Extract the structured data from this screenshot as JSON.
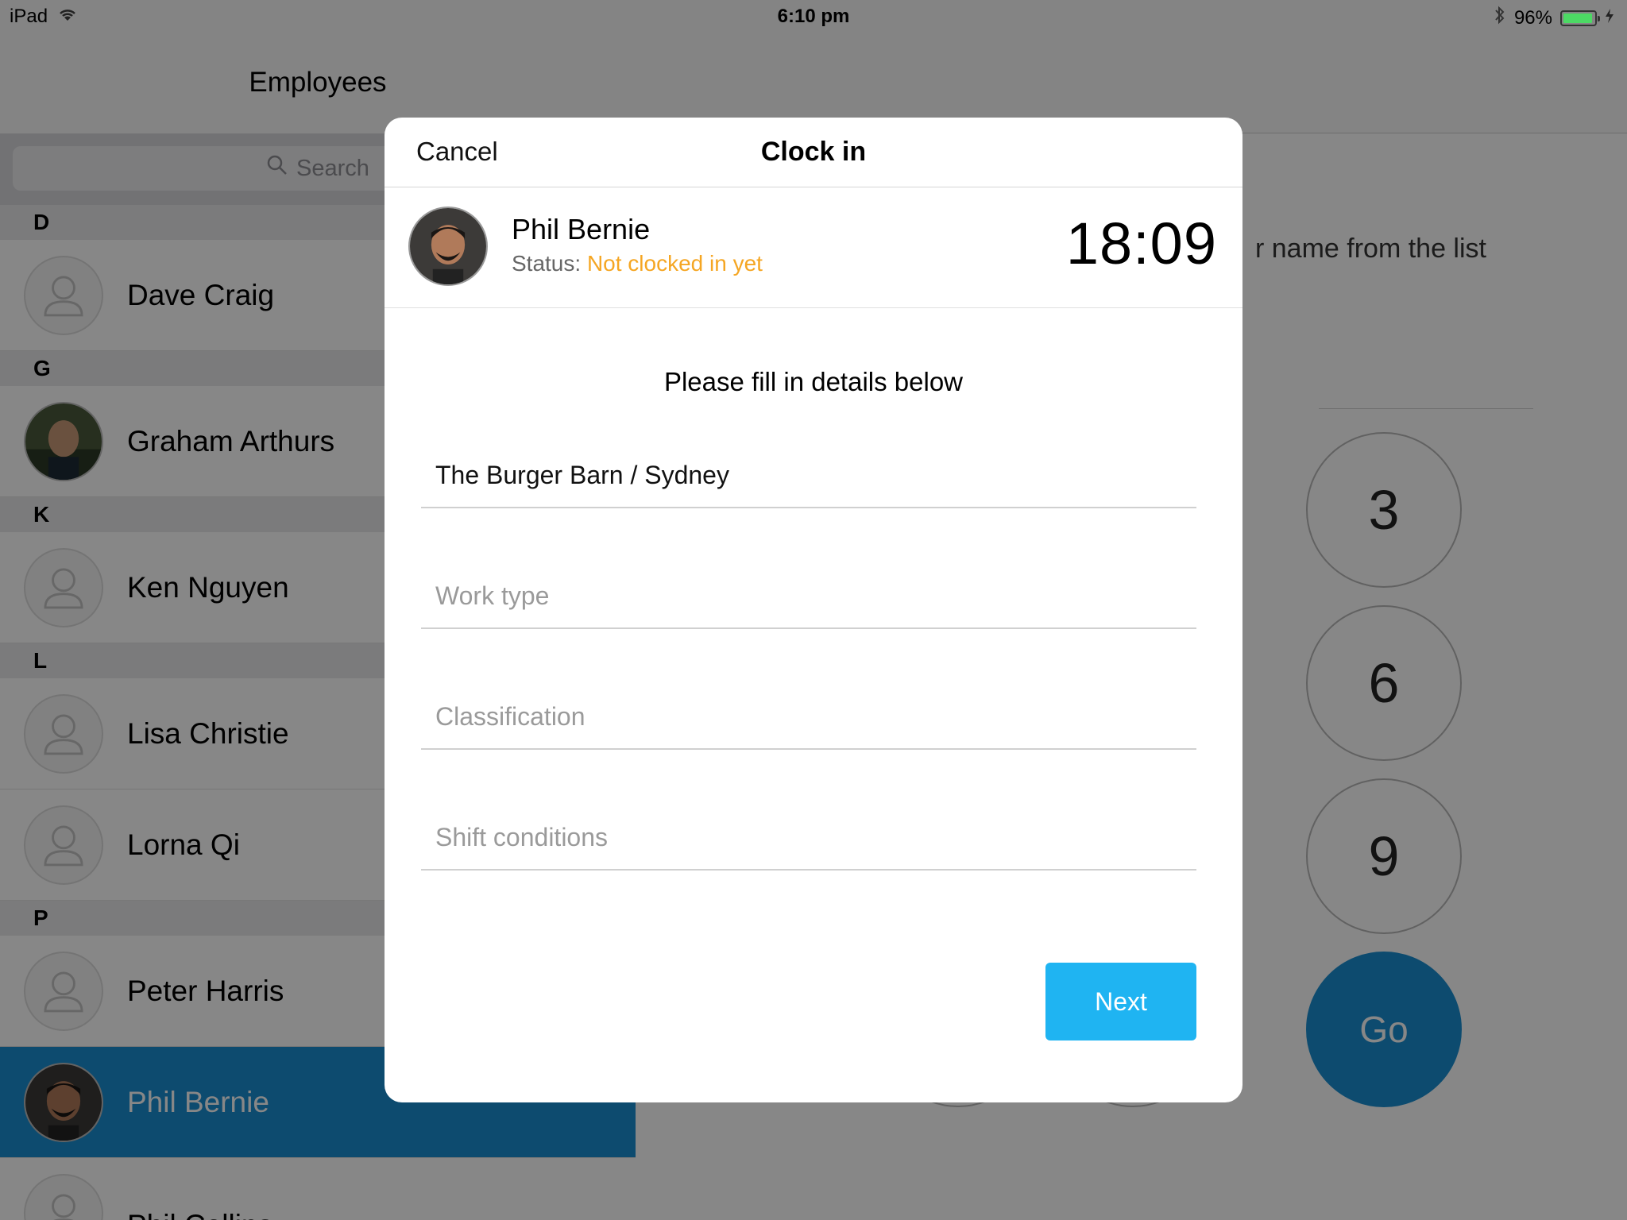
{
  "status_bar": {
    "device": "iPad",
    "time": "6:10 pm",
    "battery": "96%"
  },
  "left_panel": {
    "title": "Employees",
    "search_placeholder": "Search",
    "sections": [
      {
        "letter": "D"
      },
      {
        "letter": "G"
      },
      {
        "letter": "K"
      },
      {
        "letter": "L"
      },
      {
        "letter": "P"
      }
    ],
    "employees": [
      {
        "name": "Dave Craig"
      },
      {
        "name": "Graham Arthurs"
      },
      {
        "name": "Ken Nguyen"
      },
      {
        "name": "Lisa Christie"
      },
      {
        "name": "Lorna Qi"
      },
      {
        "name": "Peter Harris"
      },
      {
        "name": "Phil Bernie"
      },
      {
        "name": "Phil Collins"
      }
    ],
    "selected_employee": "Phil Bernie"
  },
  "right_panel": {
    "hint": "r name from the list",
    "keys": [
      "3",
      "6",
      "9"
    ],
    "go_label": "Go"
  },
  "modal": {
    "cancel_label": "Cancel",
    "title": "Clock in",
    "employee_name": "Phil Bernie",
    "status_label": "Status:",
    "status_value": "Not clocked in yet",
    "clock": "18:09",
    "instruction": "Please fill in details below",
    "fields": {
      "location": {
        "value": "The Burger Barn / Sydney",
        "placeholder": ""
      },
      "work_type": {
        "value": "",
        "placeholder": "Work type"
      },
      "classification": {
        "value": "",
        "placeholder": "Classification"
      },
      "shift_conditions": {
        "value": "",
        "placeholder": "Shift conditions"
      }
    },
    "next_label": "Next"
  },
  "colors": {
    "accent": "#1a8fd1",
    "next_button": "#1fb4f2",
    "status_warning": "#f5a623",
    "battery": "#4cd964"
  }
}
